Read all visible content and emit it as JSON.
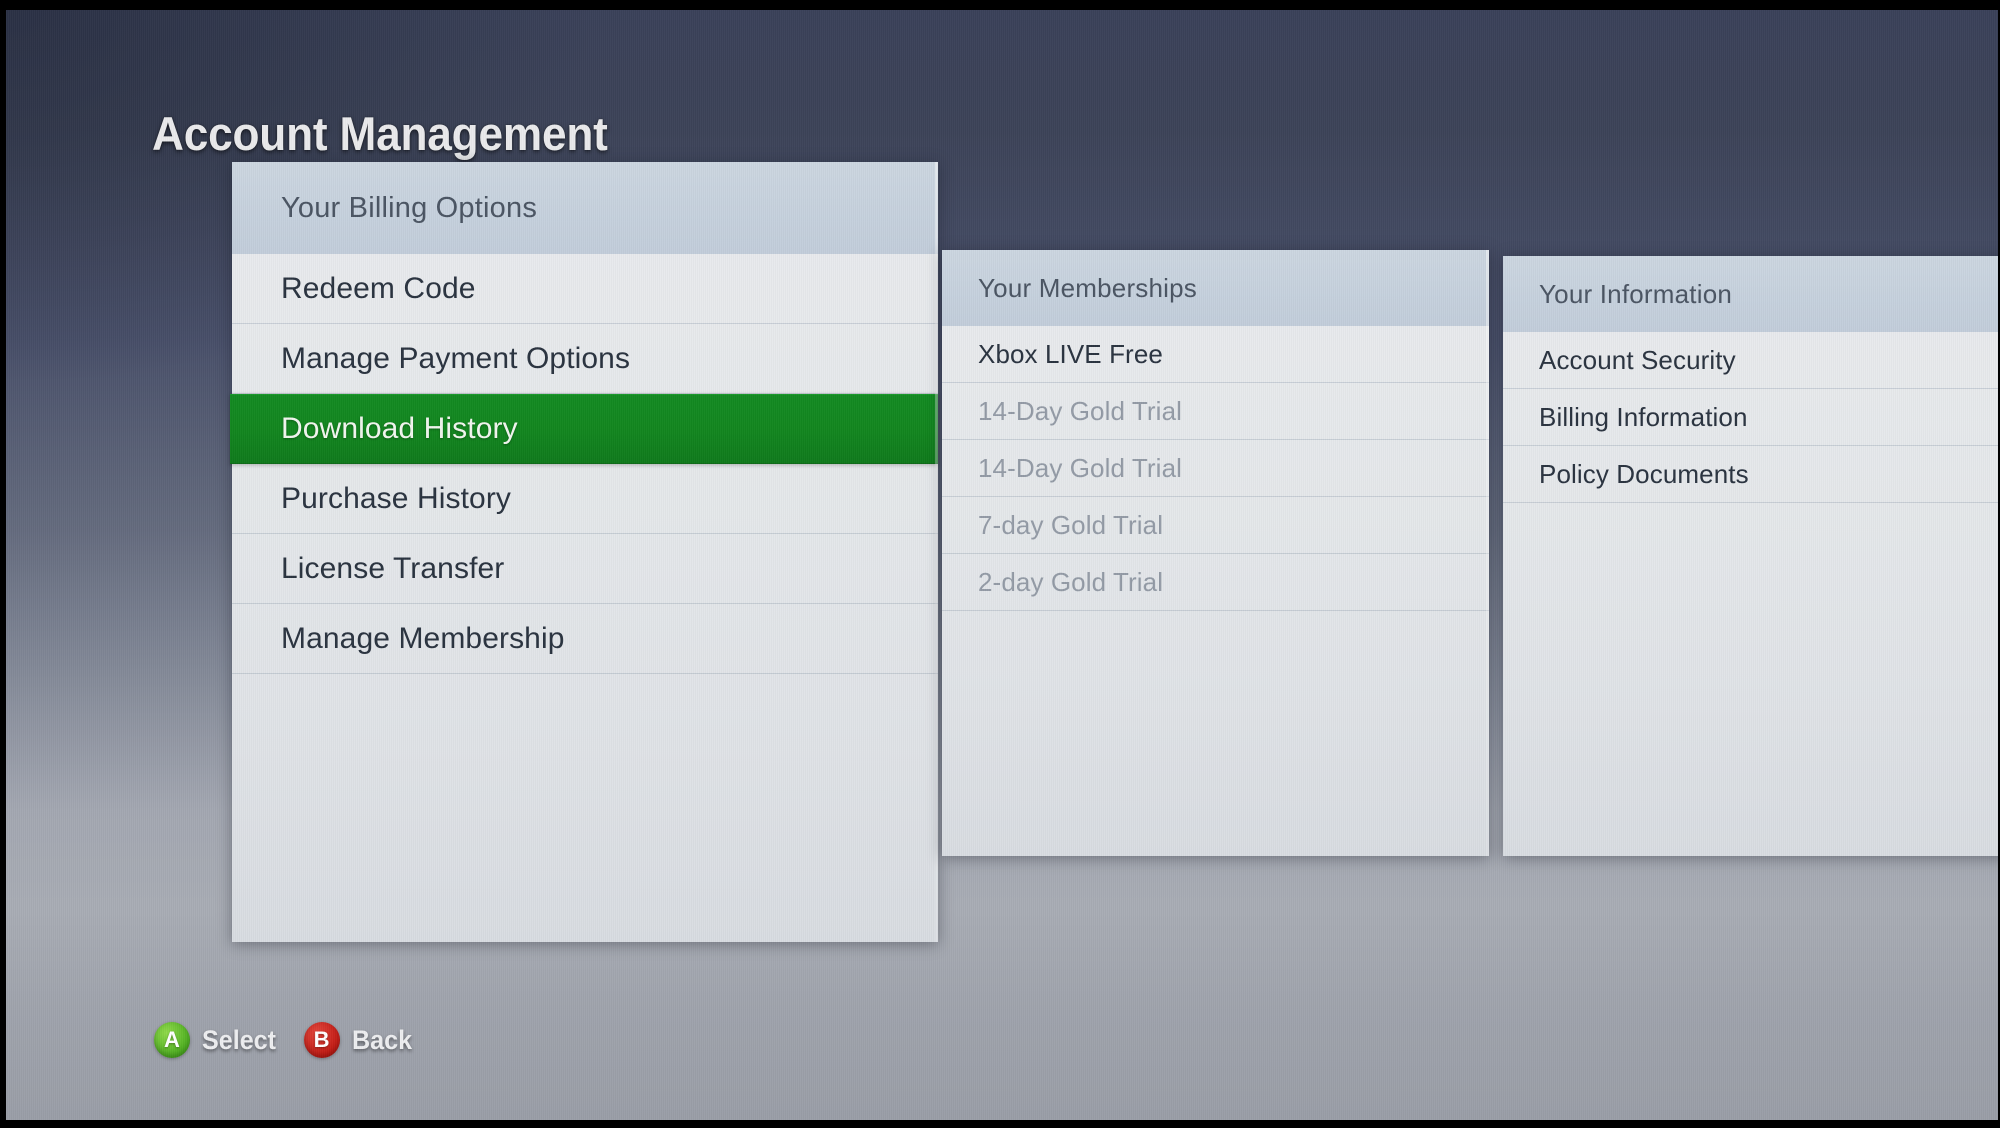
{
  "header": {
    "title": "Account Management"
  },
  "panels": {
    "billing": {
      "header": "Your Billing Options",
      "items": [
        {
          "label": "Redeem Code",
          "state": "normal"
        },
        {
          "label": "Manage Payment Options",
          "state": "normal"
        },
        {
          "label": "Download History",
          "state": "selected"
        },
        {
          "label": "Purchase History",
          "state": "normal"
        },
        {
          "label": "License Transfer",
          "state": "normal"
        },
        {
          "label": "Manage Membership",
          "state": "normal"
        }
      ]
    },
    "memberships": {
      "header": "Your Memberships",
      "items": [
        {
          "label": "Xbox LIVE Free",
          "state": "normal"
        },
        {
          "label": "14-Day Gold Trial",
          "state": "dim"
        },
        {
          "label": "14-Day Gold Trial",
          "state": "dim"
        },
        {
          "label": "7-day Gold Trial",
          "state": "dim"
        },
        {
          "label": "2-day Gold Trial",
          "state": "dim"
        }
      ]
    },
    "information": {
      "header": "Your Information",
      "items": [
        {
          "label": "Account Security",
          "state": "normal"
        },
        {
          "label": "Billing Information",
          "state": "normal"
        },
        {
          "label": "Policy Documents",
          "state": "normal"
        }
      ]
    }
  },
  "legend": [
    {
      "button": "A",
      "icon": "a-button-icon",
      "label": "Select",
      "color": "#4cae1f"
    },
    {
      "button": "B",
      "icon": "b-button-icon",
      "label": "Back",
      "color": "#c31b14"
    }
  ],
  "colors": {
    "selection_green": "#12861f",
    "background_top": "#3a4159",
    "background_bottom": "#9a9ea7",
    "panel_body": "#e4e7ea",
    "panel_header": "#c6d1dd"
  }
}
